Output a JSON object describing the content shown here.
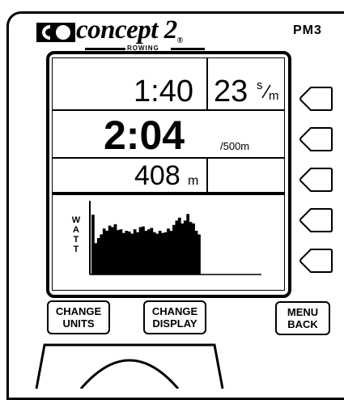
{
  "brand": {
    "name": "concept 2",
    "sub": "ROWING",
    "registered": "®",
    "model": "PM3"
  },
  "display": {
    "split_time": "1:40",
    "stroke_rate": "23",
    "stroke_rate_unit_top": "s",
    "stroke_rate_unit_bottom": "m",
    "pace": "2:04",
    "pace_unit": "/500m",
    "distance": "408",
    "distance_unit": "m",
    "graph_label": [
      "W",
      "A",
      "T",
      "T"
    ],
    "watt_history": [
      0.82,
      0.43,
      0.5,
      0.55,
      0.63,
      0.6,
      0.67,
      0.65,
      0.69,
      0.61,
      0.62,
      0.57,
      0.6,
      0.59,
      0.56,
      0.62,
      0.58,
      0.65,
      0.66,
      0.6,
      0.62,
      0.64,
      0.58,
      0.56,
      0.6,
      0.57,
      0.58,
      0.63,
      0.6,
      0.68,
      0.74,
      0.78,
      0.7,
      0.74,
      0.83,
      0.72,
      0.7,
      0.6,
      0.55
    ]
  },
  "buttons": {
    "change_units": [
      "CHANGE",
      "UNITS"
    ],
    "change_display": [
      "CHANGE",
      "DISPLAY"
    ],
    "menu_back": [
      "MENU",
      "BACK"
    ],
    "soft_keys": 5
  }
}
